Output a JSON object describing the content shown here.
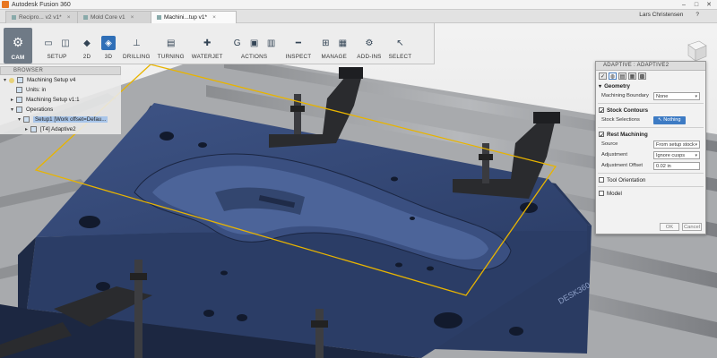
{
  "titlebar": {
    "title": "Autodesk Fusion 360"
  },
  "tabs": [
    {
      "label": "Recipro... v2 v1*"
    },
    {
      "label": "Mold Core v1"
    },
    {
      "label": "Machini...tup v1*"
    }
  ],
  "user": {
    "name": "Lars Christensen",
    "help": "?"
  },
  "toolbar": {
    "workspace": "CAM",
    "groups": [
      {
        "label": "SETUP"
      },
      {
        "label": "2D"
      },
      {
        "label": "3D"
      },
      {
        "label": "DRILLING"
      },
      {
        "label": "TURNING"
      },
      {
        "label": "WATERJET"
      },
      {
        "label": "ACTIONS"
      },
      {
        "label": "INSPECT"
      },
      {
        "label": "MANAGE"
      },
      {
        "label": "ADD-INS"
      },
      {
        "label": "SELECT"
      }
    ]
  },
  "browser": {
    "header": "BROWSER",
    "items": [
      {
        "label": "Machining Setup v4"
      },
      {
        "label": "Units: in"
      },
      {
        "label": "Machining Setup v1:1"
      },
      {
        "label": "Operations"
      },
      {
        "label": "Setup1 [Work offset=Defau..."
      },
      {
        "label": "[T4] Adaptive2"
      }
    ]
  },
  "panel": {
    "title": "ADAPTIVE : ADAPTIVE2",
    "sections": {
      "geometry": "Geometry",
      "machining_boundary_label": "Machining Boundary",
      "machining_boundary_value": "None",
      "stock_contours": "Stock Contours",
      "stock_selections_label": "Stock Selections",
      "stock_selections_value": "Nothing",
      "rest_machining": "Rest Machining",
      "source_label": "Source",
      "source_value": "From setup stock",
      "adjustment_label": "Adjustment",
      "adjustment_value": "Ignore cusps",
      "adjustment_offset_label": "Adjustment Offset",
      "adjustment_offset_value": "0.02 in",
      "tool_orientation": "Tool Orientation",
      "model": "Model"
    },
    "ok": "OK",
    "cancel": "Cancel"
  },
  "model": {
    "engraving": "DESK360"
  }
}
